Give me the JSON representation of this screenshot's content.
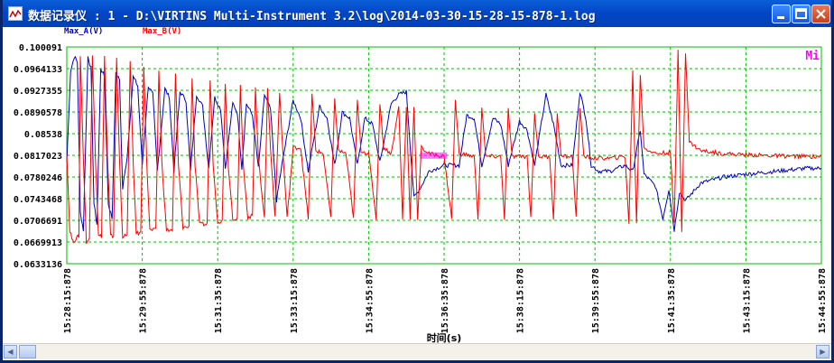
{
  "window": {
    "title": "数据记录仪 : 1 - D:\\VIRTINS Multi-Instrument 3.2\\log\\2014-03-30-15-28-15-878-1.log",
    "minimize_icon": "minimize-icon",
    "maximize_icon": "maximize-icon",
    "close_icon": "close-icon"
  },
  "colors": {
    "series_a": "#0000c0",
    "series_b": "#ff0000",
    "grid": "#00c000",
    "marker": "#ff00ff"
  },
  "chart_data": {
    "type": "line",
    "xlabel": "时间(s)",
    "ylabel": "",
    "ylim": [
      0.0633136,
      0.100091
    ],
    "y_ticks": [
      "0.100091",
      "0.0964133",
      "0.0927355",
      "0.0890578",
      "0.08538",
      "0.0817023",
      "0.0780246",
      "0.0743468",
      "0.0706691",
      "0.0669913",
      "0.0633136"
    ],
    "x_ticks": [
      "15:28:15:878",
      "15:29:55:878",
      "15:31:35:878",
      "15:33:15:878",
      "15:34:55:878",
      "15:36:35:878",
      "15:38:15:878",
      "15:39:55:878",
      "15:41:35:878",
      "15:43:15:878",
      "15:44:55:878"
    ],
    "x_range_seconds": [
      0,
      1000
    ],
    "grid": true,
    "legend_position": "top-left",
    "annotation": "Mi",
    "series": [
      {
        "name": "Max_A(V)",
        "points": [
          [
            0,
            0.0805
          ],
          [
            5,
            0.096
          ],
          [
            10,
            0.0985
          ],
          [
            14,
            0.0975
          ],
          [
            18,
            0.072
          ],
          [
            22,
            0.069
          ],
          [
            28,
            0.0985
          ],
          [
            32,
            0.0965
          ],
          [
            36,
            0.0735
          ],
          [
            40,
            0.07
          ],
          [
            45,
            0.0965
          ],
          [
            50,
            0.095
          ],
          [
            55,
            0.0735
          ],
          [
            60,
            0.071
          ],
          [
            65,
            0.0955
          ],
          [
            70,
            0.0945
          ],
          [
            74,
            0.076
          ],
          [
            80,
            0.0815
          ],
          [
            88,
            0.095
          ],
          [
            94,
            0.0935
          ],
          [
            100,
            0.08
          ],
          [
            108,
            0.0935
          ],
          [
            114,
            0.092
          ],
          [
            120,
            0.079
          ],
          [
            130,
            0.093
          ],
          [
            136,
            0.0915
          ],
          [
            142,
            0.079
          ],
          [
            150,
            0.0925
          ],
          [
            158,
            0.091
          ],
          [
            164,
            0.079
          ],
          [
            172,
            0.092
          ],
          [
            180,
            0.09
          ],
          [
            188,
            0.0795
          ],
          [
            196,
            0.0915
          ],
          [
            204,
            0.0895
          ],
          [
            210,
            0.0795
          ],
          [
            220,
            0.0905
          ],
          [
            226,
            0.089
          ],
          [
            232,
            0.0795
          ],
          [
            238,
            0.0905
          ],
          [
            246,
            0.0885
          ],
          [
            254,
            0.0795
          ],
          [
            262,
            0.092
          ],
          [
            270,
            0.0895
          ],
          [
            278,
            0.074
          ],
          [
            285,
            0.08
          ],
          [
            300,
            0.091
          ],
          [
            310,
            0.088
          ],
          [
            320,
            0.079
          ],
          [
            335,
            0.09
          ],
          [
            345,
            0.088
          ],
          [
            355,
            0.08
          ],
          [
            365,
            0.089
          ],
          [
            375,
            0.088
          ],
          [
            385,
            0.08
          ],
          [
            395,
            0.088
          ],
          [
            405,
            0.087
          ],
          [
            415,
            0.0805
          ],
          [
            430,
            0.0905
          ],
          [
            440,
            0.092
          ],
          [
            450,
            0.0925
          ],
          [
            460,
            0.0745
          ],
          [
            470,
            0.0765
          ],
          [
            480,
            0.079
          ],
          [
            500,
            0.08
          ],
          [
            520,
            0.08
          ],
          [
            530,
            0.0885
          ],
          [
            540,
            0.088
          ],
          [
            550,
            0.08
          ],
          [
            565,
            0.088
          ],
          [
            575,
            0.087
          ],
          [
            585,
            0.08
          ],
          [
            600,
            0.0875
          ],
          [
            610,
            0.086
          ],
          [
            620,
            0.08
          ],
          [
            635,
            0.092
          ],
          [
            645,
            0.087
          ],
          [
            655,
            0.08
          ],
          [
            670,
            0.08
          ],
          [
            680,
            0.0925
          ],
          [
            688,
            0.088
          ],
          [
            695,
            0.08
          ],
          [
            705,
            0.079
          ],
          [
            720,
            0.079
          ],
          [
            740,
            0.08
          ],
          [
            750,
            0.079
          ],
          [
            760,
            0.086
          ],
          [
            765,
            0.0785
          ],
          [
            780,
            0.0765
          ],
          [
            790,
            0.071
          ],
          [
            798,
            0.076
          ],
          [
            805,
            0.069
          ],
          [
            812,
            0.0755
          ],
          [
            820,
            0.074
          ],
          [
            840,
            0.077
          ],
          [
            870,
            0.078
          ],
          [
            900,
            0.0785
          ],
          [
            940,
            0.079
          ],
          [
            980,
            0.0795
          ],
          [
            1000,
            0.0795
          ]
        ]
      },
      {
        "name": "Max_B(V)",
        "points": [
          [
            0,
            0.082
          ],
          [
            4,
            0.069
          ],
          [
            8,
            0.067
          ],
          [
            12,
            0.0675
          ],
          [
            16,
            0.068
          ],
          [
            18,
            0.0985
          ],
          [
            22,
            0.081
          ],
          [
            26,
            0.067
          ],
          [
            30,
            0.0675
          ],
          [
            34,
            0.099
          ],
          [
            38,
            0.081
          ],
          [
            42,
            0.068
          ],
          [
            46,
            0.068
          ],
          [
            50,
            0.0985
          ],
          [
            54,
            0.081
          ],
          [
            58,
            0.068
          ],
          [
            62,
            0.068
          ],
          [
            66,
            0.098
          ],
          [
            70,
            0.0805
          ],
          [
            74,
            0.068
          ],
          [
            80,
            0.068
          ],
          [
            84,
            0.0975
          ],
          [
            88,
            0.0805
          ],
          [
            92,
            0.0685
          ],
          [
            98,
            0.0685
          ],
          [
            102,
            0.097
          ],
          [
            106,
            0.0805
          ],
          [
            110,
            0.069
          ],
          [
            118,
            0.069
          ],
          [
            122,
            0.096
          ],
          [
            126,
            0.0805
          ],
          [
            132,
            0.069
          ],
          [
            140,
            0.069
          ],
          [
            144,
            0.0955
          ],
          [
            148,
            0.08
          ],
          [
            154,
            0.0695
          ],
          [
            162,
            0.0695
          ],
          [
            166,
            0.095
          ],
          [
            170,
            0.08
          ],
          [
            176,
            0.07
          ],
          [
            186,
            0.07
          ],
          [
            190,
            0.0945
          ],
          [
            194,
            0.08
          ],
          [
            200,
            0.0705
          ],
          [
            206,
            0.0705
          ],
          [
            210,
            0.094
          ],
          [
            214,
            0.08
          ],
          [
            220,
            0.071
          ],
          [
            226,
            0.071
          ],
          [
            230,
            0.0935
          ],
          [
            234,
            0.08
          ],
          [
            240,
            0.071
          ],
          [
            246,
            0.0715
          ],
          [
            250,
            0.0935
          ],
          [
            254,
            0.081
          ],
          [
            262,
            0.071
          ],
          [
            266,
            0.093
          ],
          [
            270,
            0.083
          ],
          [
            276,
            0.071
          ],
          [
            282,
            0.0925
          ],
          [
            286,
            0.083
          ],
          [
            292,
            0.071
          ],
          [
            300,
            0.083
          ],
          [
            310,
            0.083
          ],
          [
            320,
            0.071
          ],
          [
            325,
            0.092
          ],
          [
            330,
            0.0825
          ],
          [
            340,
            0.082
          ],
          [
            350,
            0.071
          ],
          [
            355,
            0.0915
          ],
          [
            360,
            0.0825
          ],
          [
            370,
            0.082
          ],
          [
            380,
            0.071
          ],
          [
            385,
            0.091
          ],
          [
            390,
            0.0825
          ],
          [
            400,
            0.082
          ],
          [
            410,
            0.071
          ],
          [
            415,
            0.0905
          ],
          [
            420,
            0.083
          ],
          [
            430,
            0.082
          ],
          [
            440,
            0.09
          ],
          [
            445,
            0.071
          ],
          [
            450,
            0.09
          ],
          [
            455,
            0.071
          ],
          [
            460,
            0.09
          ],
          [
            465,
            0.071
          ],
          [
            470,
            0.083
          ],
          [
            480,
            0.082
          ],
          [
            500,
            0.0815
          ],
          [
            510,
            0.071
          ],
          [
            515,
            0.091
          ],
          [
            520,
            0.082
          ],
          [
            540,
            0.0815
          ],
          [
            545,
            0.071
          ],
          [
            550,
            0.09
          ],
          [
            555,
            0.0815
          ],
          [
            575,
            0.0815
          ],
          [
            580,
            0.071
          ],
          [
            585,
            0.0895
          ],
          [
            590,
            0.0815
          ],
          [
            610,
            0.0815
          ],
          [
            615,
            0.071
          ],
          [
            620,
            0.089
          ],
          [
            625,
            0.0815
          ],
          [
            640,
            0.0815
          ],
          [
            645,
            0.071
          ],
          [
            650,
            0.089
          ],
          [
            655,
            0.0815
          ],
          [
            670,
            0.0815
          ],
          [
            675,
            0.071
          ],
          [
            680,
            0.09
          ],
          [
            685,
            0.0815
          ],
          [
            700,
            0.0812
          ],
          [
            720,
            0.0812
          ],
          [
            740,
            0.0815
          ],
          [
            745,
            0.07
          ],
          [
            750,
            0.096
          ],
          [
            755,
            0.07
          ],
          [
            760,
            0.0955
          ],
          [
            765,
            0.083
          ],
          [
            780,
            0.082
          ],
          [
            800,
            0.0822
          ],
          [
            805,
            0.07
          ],
          [
            810,
            0.0995
          ],
          [
            815,
            0.069
          ],
          [
            820,
            0.099
          ],
          [
            825,
            0.084
          ],
          [
            840,
            0.0825
          ],
          [
            870,
            0.082
          ],
          [
            900,
            0.0818
          ],
          [
            940,
            0.0816
          ],
          [
            980,
            0.0815
          ],
          [
            1000,
            0.0815
          ]
        ]
      }
    ]
  },
  "scrollbar": {
    "left_arrow": "◀",
    "right_arrow": "▶"
  }
}
